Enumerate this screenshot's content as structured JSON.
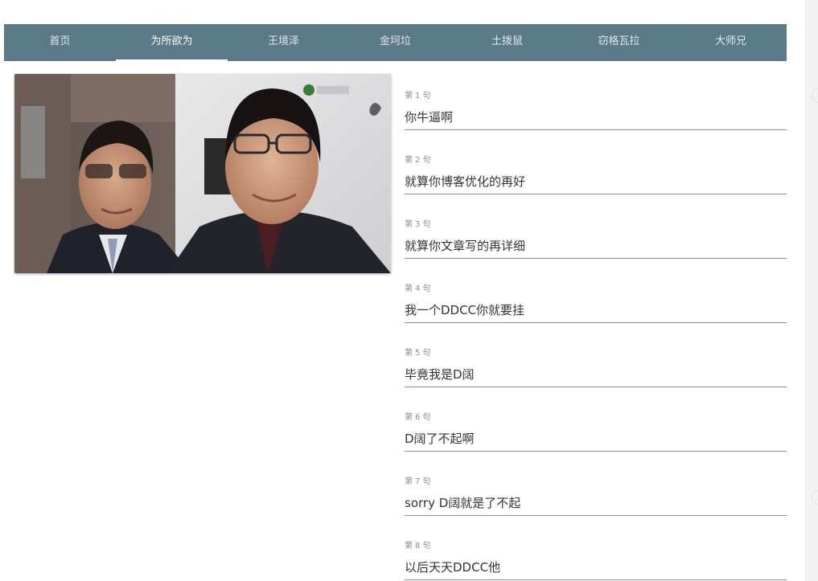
{
  "nav": {
    "tabs": [
      {
        "label": "首页",
        "active": false
      },
      {
        "label": "为所欲为",
        "active": true
      },
      {
        "label": "王境泽",
        "active": false
      },
      {
        "label": "金坷垃",
        "active": false
      },
      {
        "label": "土拨鼠",
        "active": false
      },
      {
        "label": "窃格瓦拉",
        "active": false
      },
      {
        "label": "大师兄",
        "active": false
      }
    ]
  },
  "lines": {
    "prefix": "第",
    "suffix": "句",
    "items": [
      {
        "index": "1",
        "text": "你牛逼啊"
      },
      {
        "index": "2",
        "text": "就算你博客优化的再好"
      },
      {
        "index": "3",
        "text": "就算你文章写的再详细"
      },
      {
        "index": "4",
        "text": "我一个DDCC你就要挂"
      },
      {
        "index": "5",
        "text": "毕竟我是D阔"
      },
      {
        "index": "6",
        "text": "D阔了不起啊"
      },
      {
        "index": "7",
        "text": "sorry D阔就是了不起"
      },
      {
        "index": "8",
        "text": "以后天天DDCC他"
      }
    ]
  },
  "colors": {
    "nav_background": "#5a7a87",
    "nav_text": "#dfe8ec",
    "nav_active_indicator": "#ffffff",
    "line_text": "#333333",
    "line_index": "#8c8c8c",
    "divider": "#8a8a8a"
  }
}
